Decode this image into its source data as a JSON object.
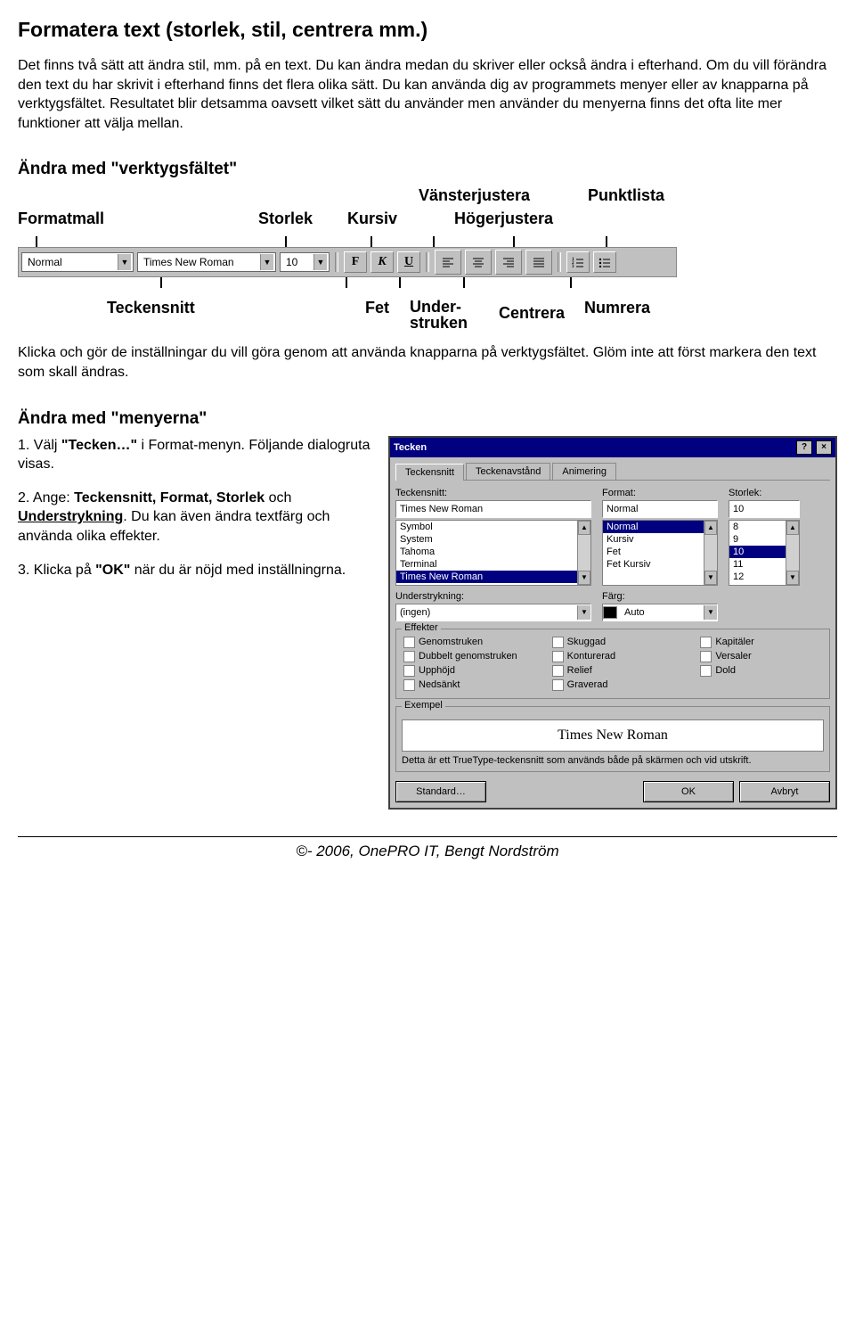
{
  "title": "Formatera text (storlek, stil, centrera mm.)",
  "intro": "Det finns två sätt att ändra stil, mm. på en text. Du kan ändra medan du skriver eller också ändra i efterhand. Om du vill förändra den text du har skrivit i efterhand finns det flera olika sätt. Du kan använda dig av programmets menyer eller av knapparna på verktygsfältet. Resultatet blir detsamma oavsett vilket sätt du använder men använder du menyerna finns det ofta lite mer funktioner att välja mellan.",
  "section1": "Ändra med \"verktygsfältet\"",
  "toolbar_labels": {
    "vansterjustera": "Vänsterjustera",
    "punktlista": "Punktlista",
    "formatmall": "Formatmall",
    "storlek": "Storlek",
    "kursiv": "Kursiv",
    "hogerjustera": "Högerjustera",
    "teckensnitt": "Teckensnitt",
    "fet": "Fet",
    "understruken_l1": "Under-",
    "understruken_l2": "struken",
    "centrera": "Centrera",
    "numrera": "Numrera"
  },
  "toolbar": {
    "style": "Normal",
    "font": "Times New Roman",
    "size": "10",
    "bold": "F",
    "italic": "K",
    "underline": "U"
  },
  "section1_text": "Klicka och gör de inställningar du vill göra genom att använda knapparna på verktygsfältet. Glöm inte att först markera den text som skall ändras.",
  "section2": "Ändra med \"menyerna\"",
  "steps": {
    "s1a": "1. Välj ",
    "s1b": "\"Tecken…\"",
    "s1c": " i Format-menyn. Följande dialogruta visas.",
    "s2a": "2. Ange: ",
    "s2b": "Teckensnitt, Format, Storlek",
    "s2c": " och ",
    "s2d": "Understrykning",
    "s2e": ". Du kan även ändra textfärg och använda olika effekter.",
    "s3a": "3. Klicka på ",
    "s3b": "\"OK\"",
    "s3c": " när du är nöjd med inställningrna."
  },
  "dialog": {
    "title": "Tecken",
    "tabs": [
      "Teckensnitt",
      "Teckenavstånd",
      "Animering"
    ],
    "font_label": "Teckensnitt:",
    "font_value": "Times New Roman",
    "font_list": [
      "Symbol",
      "System",
      "Tahoma",
      "Terminal",
      "Times New Roman"
    ],
    "format_label": "Format:",
    "format_value": "Normal",
    "format_list": [
      "Normal",
      "Kursiv",
      "Fet",
      "Fet Kursiv"
    ],
    "size_label": "Storlek:",
    "size_value": "10",
    "size_list": [
      "8",
      "9",
      "10",
      "11",
      "12"
    ],
    "underline_label": "Understrykning:",
    "underline_value": "(ingen)",
    "color_label": "Färg:",
    "color_value": "Auto",
    "effects_label": "Effekter",
    "effects_col1": [
      "Genomstruken",
      "Dubbelt genomstruken",
      "Upphöjd",
      "Nedsänkt"
    ],
    "effects_col2": [
      "Skuggad",
      "Konturerad",
      "Relief",
      "Graverad"
    ],
    "effects_col3": [
      "Kapitäler",
      "Versaler",
      "Dold"
    ],
    "exempel_label": "Exempel",
    "preview": "Times New Roman",
    "note": "Detta är ett TrueType-teckensnitt som används både på skärmen och vid utskrift.",
    "btn_standard": "Standard…",
    "btn_ok": "OK",
    "btn_cancel": "Avbryt"
  },
  "footer": "©- 2006, OnePRO IT, Bengt Nordström"
}
